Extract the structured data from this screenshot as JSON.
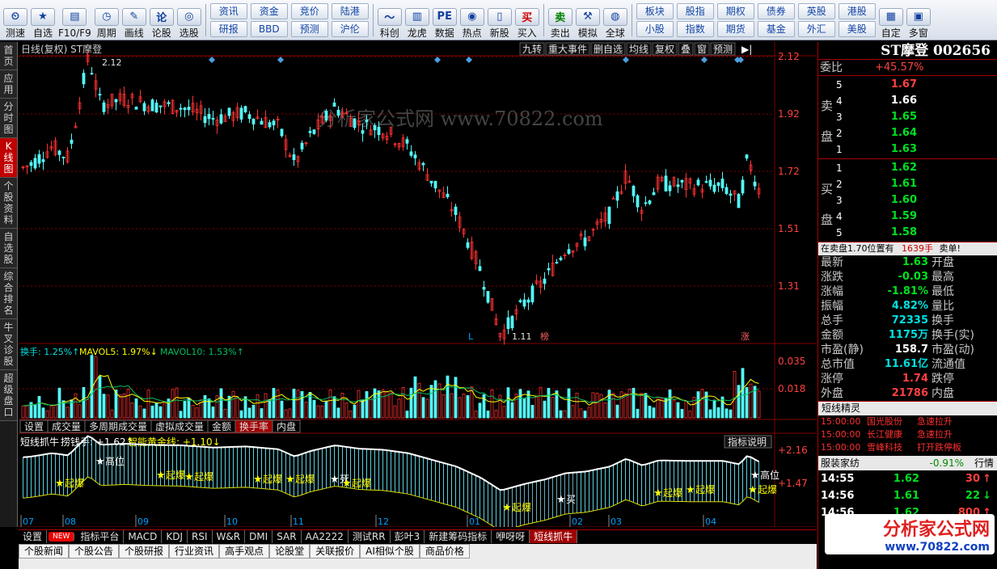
{
  "toolbar": {
    "items": [
      "测速",
      "自选",
      "F10/F9",
      "周期",
      "画线",
      "论股",
      "选股",
      "科创",
      "龙虎",
      "数据",
      "热点",
      "新股",
      "买入",
      "卖出",
      "模拟",
      "全球",
      "自定",
      "多窗"
    ],
    "pairs": [
      [
        "资讯",
        "研报"
      ],
      [
        "资金",
        "BBD"
      ],
      [
        "竞价",
        "预测"
      ],
      [
        "陆港",
        "沪伦"
      ],
      [
        "板块",
        "小股"
      ],
      [
        "股指",
        "指数"
      ],
      [
        "期权",
        "期货"
      ],
      [
        "债券",
        "基金"
      ],
      [
        "英股",
        "外汇"
      ],
      [
        "港股",
        "美股"
      ]
    ]
  },
  "left_tabs": [
    "首页",
    "应用",
    "分时图",
    "K线图",
    "个股资料",
    "自选股",
    "综合排名",
    "牛叉诊股",
    "超级盘口"
  ],
  "left_tab_active": "K线图",
  "chart": {
    "header": "日线(复权)  ST摩登",
    "header_buttons": [
      "九转",
      "重大事件",
      "删自选",
      "均线",
      "复权",
      "叠",
      "窗",
      "预测"
    ],
    "price_ticks": [
      "2.12",
      "1.92",
      "1.72",
      "1.51",
      "1.31"
    ],
    "high_label": "2.12",
    "low_label": "1.11",
    "marker_L": "L",
    "marker_bang": "榜",
    "marker_zhang": "涨",
    "watermark": "分析家公式网 www.70822.com",
    "vol_header": {
      "a": "换手: 1.25%↑",
      "b": "MAVOL5: 1.97%↓",
      "c": "MAVOL10: 1.53%↑"
    },
    "vol_ticks": [
      "0.035",
      "0.018"
    ],
    "mid_tabs": [
      "设置",
      "成交量",
      "多周期成交量",
      "虚拟成交量",
      "金额",
      "换手率",
      "内盘"
    ],
    "mid_tab_active": "换手率",
    "ind_header": {
      "a": "短线抓牛",
      "b": "捞钱手: +1.62↑",
      "c": "智能黄金线: +1.10↓"
    },
    "ind_button": "指标说明",
    "ind_ticks": [
      "+2.16",
      "+1.47"
    ],
    "months": [
      "07",
      "08",
      "09",
      "10",
      "11",
      "12",
      "01",
      "02",
      "03",
      "04"
    ],
    "signal_labels": {
      "high": "高位",
      "boom": "起爆",
      "dead": "死",
      "buy": "买"
    },
    "series_seed": "candles generated procedurally"
  },
  "bottom_tabs": [
    "设置",
    "NEW",
    "指标平台",
    "MACD",
    "KDJ",
    "RSI",
    "W&R",
    "DMI",
    "SAR",
    "AA2222",
    "测试RR",
    "彭叶3",
    "新建筹码指标",
    "咿呀呀",
    "短线抓牛"
  ],
  "bottom_tab_active": "短线抓牛",
  "info_tabs": [
    "个股新闻",
    "个股公告",
    "个股研报",
    "行业资讯",
    "高手观点",
    "论股堂",
    "关联报价",
    "AI相似个股",
    "商品价格"
  ],
  "quote": {
    "title": "ST摩登 002656",
    "weibi_label": "委比",
    "weibi": "+45.57%",
    "sell_label": "卖盘",
    "buy_label": "买盘",
    "sell": [
      [
        "5",
        "1.67",
        "red"
      ],
      [
        "4",
        "1.66",
        "white"
      ],
      [
        "3",
        "1.65",
        "green"
      ],
      [
        "2",
        "1.64",
        "green"
      ],
      [
        "1",
        "1.63",
        "green"
      ]
    ],
    "buy": [
      [
        "1",
        "1.62",
        "green"
      ],
      [
        "2",
        "1.61",
        "green"
      ],
      [
        "3",
        "1.60",
        "green"
      ],
      [
        "4",
        "1.59",
        "green"
      ],
      [
        "5",
        "1.58",
        "green"
      ]
    ],
    "note": "在卖盘1.70位置有",
    "note2": "1639手",
    "note3": "卖单!",
    "stats": [
      [
        "最新",
        "1.63",
        "green",
        "开盘",
        ""
      ],
      [
        "涨跌",
        "-0.03",
        "green",
        "最高",
        ""
      ],
      [
        "涨幅",
        "-1.81%",
        "green",
        "最低",
        ""
      ],
      [
        "振幅",
        "4.82%",
        "cyan",
        "量比",
        ""
      ],
      [
        "总手",
        "72335",
        "cyan",
        "换手",
        ""
      ],
      [
        "金额",
        "1175万",
        "cyan",
        "换手(实)",
        ""
      ],
      [
        "市盈(静)",
        "158.7",
        "white",
        "市盈(动)",
        ""
      ],
      [
        "总市值",
        "11.61亿",
        "cyan",
        "流通值",
        ""
      ],
      [
        "涨停",
        "1.74",
        "red",
        "跌停",
        ""
      ],
      [
        "外盘",
        "21786",
        "red",
        "内盘",
        ""
      ]
    ],
    "sprite_title": "短线精灵",
    "sprite": [
      [
        "15:00:00",
        "国光股份",
        "急速拉升"
      ],
      [
        "15:00:00",
        "长江健康",
        "急速拉升"
      ],
      [
        "15:00:00",
        "雪峰科技",
        "打开跌停板"
      ]
    ],
    "sector_name": "服装家纺",
    "sector_chg": "-0.91%",
    "sector_btn": "行情",
    "ticks": [
      [
        "14:55",
        "1.62",
        "30",
        "red"
      ],
      [
        "14:56",
        "1.61",
        "22",
        "green"
      ],
      [
        "14:56",
        "1.62",
        "800",
        "red"
      ]
    ]
  },
  "logo": {
    "cn": "分析家公式网",
    "url": "www.70822.com"
  },
  "colors": {
    "up": "#ff3232",
    "down": "#54fcfc",
    "bg": "#000000",
    "grid": "#800000"
  }
}
